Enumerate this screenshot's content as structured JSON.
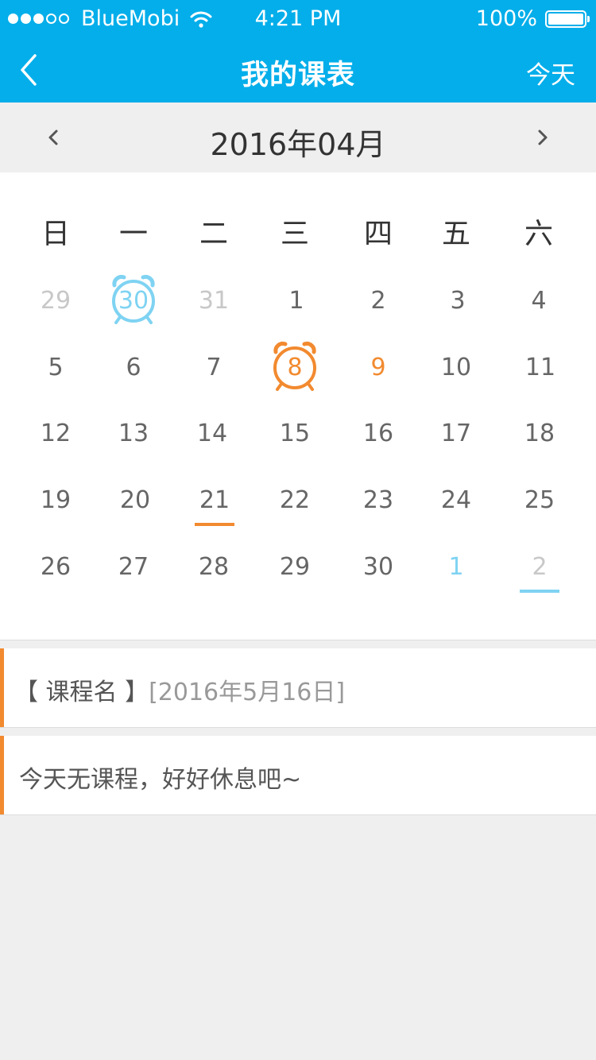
{
  "status": {
    "carrier": "BlueMobi",
    "time": "4:21 PM",
    "battery": "100%"
  },
  "nav": {
    "title": "我的课表",
    "today_label": "今天"
  },
  "month": {
    "label": "2016年04月"
  },
  "weekdays": [
    "日",
    "一",
    "二",
    "三",
    "四",
    "五",
    "六"
  ],
  "weeks": [
    [
      "29",
      "30",
      "31",
      "1",
      "2",
      "3",
      "4"
    ],
    [
      "5",
      "6",
      "7",
      "8",
      "9",
      "10",
      "11"
    ],
    [
      "12",
      "13",
      "14",
      "15",
      "16",
      "17",
      "18"
    ],
    [
      "19",
      "20",
      "21",
      "22",
      "23",
      "24",
      "25"
    ],
    [
      "26",
      "27",
      "28",
      "29",
      "30",
      "1",
      "2"
    ]
  ],
  "colors": {
    "primary": "#03aeea",
    "accent_orange": "#f28a2f",
    "accent_blue": "#7fd3f2"
  },
  "cards": [
    {
      "name": "【 课程名 】",
      "date": "[2016年5月16日]"
    },
    {
      "text": "今天无课程，好好休息吧~"
    }
  ]
}
